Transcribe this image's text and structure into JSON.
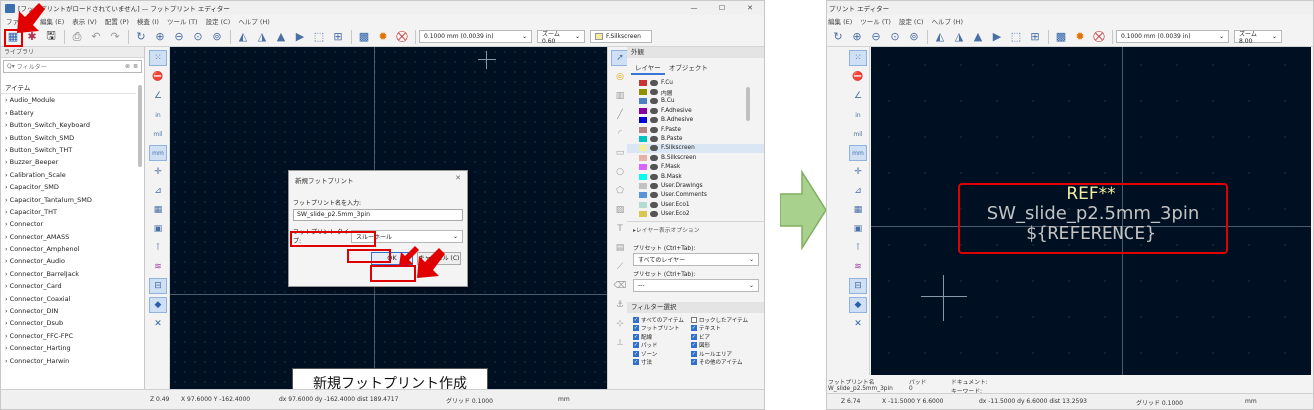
{
  "left": {
    "title": "[フットプリントがロードされていません] — フットプリント エディター",
    "menu": [
      "ファイル",
      "編集 (E)",
      "表示 (V)",
      "配置 (P)",
      "検査 (I)",
      "ツール (T)",
      "設定 (C)",
      "ヘルプ (H)"
    ],
    "grid_combo": "0.1000 mm (0.0039 in)",
    "zoom_combo": "ズーム 0.60",
    "layer_combo": "F.Silkscreen",
    "library": {
      "header": "ライブラリ",
      "search_placeholder": "フィルター",
      "column": "アイテム",
      "items": [
        "Audio_Module",
        "Battery",
        "Button_Switch_Keyboard",
        "Button_Switch_SMD",
        "Button_Switch_THT",
        "Buzzer_Beeper",
        "Calibration_Scale",
        "Capacitor_SMD",
        "Capacitor_Tantalum_SMD",
        "Capacitor_THT",
        "Connector",
        "Connector_AMASS",
        "Connector_Amphenol",
        "Connector_Audio",
        "Connector_BarrelJack",
        "Connector_Card",
        "Connector_Coaxial",
        "Connector_DIN",
        "Connector_Dsub",
        "Connector_FFC-FPC",
        "Connector_Harting",
        "Connector_Harwin"
      ]
    },
    "appearance": {
      "title": "外観",
      "tab_layers": "レイヤー",
      "tab_objects": "オブジェクト",
      "layers": [
        {
          "name": "F.Cu",
          "color": "#c83434"
        },
        {
          "name": "内層",
          "color": "#8f8f00"
        },
        {
          "name": "B.Cu",
          "color": "#4d7fc4"
        },
        {
          "name": "F.Adhesive",
          "color": "#84009e"
        },
        {
          "name": "B.Adhesive",
          "color": "#0000d4"
        },
        {
          "name": "F.Paste",
          "color": "#b48484"
        },
        {
          "name": "B.Paste",
          "color": "#00c2c2"
        },
        {
          "name": "F.Silkscreen",
          "color": "#f2eda1"
        },
        {
          "name": "B.Silkscreen",
          "color": "#e8b2a7"
        },
        {
          "name": "F.Mask",
          "color": "#d864ff"
        },
        {
          "name": "B.Mask",
          "color": "#02ffee"
        },
        {
          "name": "User.Drawings",
          "color": "#c2c2c2"
        },
        {
          "name": "User.Comments",
          "color": "#5994dc"
        },
        {
          "name": "User.Eco1",
          "color": "#b4dbd2"
        },
        {
          "name": "User.Eco2",
          "color": "#d8c852"
        }
      ],
      "layer_display_options": "▸レイヤー表示オプション",
      "preset_label": "プリセット (Ctrl+Tab):",
      "preset_value": "すべてのレイヤー",
      "viewport_label": "プリセット (Ctrl+Tab):",
      "viewport_value": "---",
      "filter_title": "フィルター選択",
      "filters": [
        {
          "label": "すべてのアイテム",
          "checked": true
        },
        {
          "label": "ロックしたアイテム",
          "checked": false
        },
        {
          "label": "フットプリント",
          "checked": true
        },
        {
          "label": "テキスト",
          "checked": true
        },
        {
          "label": "配線",
          "checked": true
        },
        {
          "label": "ビア",
          "checked": true
        },
        {
          "label": "パッド",
          "checked": true
        },
        {
          "label": "図形",
          "checked": true
        },
        {
          "label": "ゾーン",
          "checked": true
        },
        {
          "label": "ルールエリア",
          "checked": true
        },
        {
          "label": "寸法",
          "checked": true
        },
        {
          "label": "その他のアイテム",
          "checked": true
        }
      ]
    },
    "dialog": {
      "title": "新規フットプリント",
      "name_label": "フットプリント名を入力:",
      "name_value": "SW_slide_p2.5mm_3pin",
      "type_label": "フットプリント タイプ:",
      "type_value": "スルーホール",
      "ok": "OK",
      "cancel": "キャンセル (C)"
    },
    "caption": "新規フットプリント作成",
    "status": {
      "zoom": "Z 0.49",
      "xy": "X 97.6000  Y -162.4000",
      "d": "dx 97.6000  dy -162.4000  dist 189.4717",
      "grid": "グリッド 0.1000",
      "unit": "mm"
    }
  },
  "right": {
    "title": "プリント エディター",
    "menu": [
      "編集 (E)",
      "ツール (T)",
      "設定 (C)",
      "ヘルプ (H)"
    ],
    "grid_combo": "0.1000 mm (0.0039 in)",
    "zoom_combo": "ズーム 8.00",
    "footprint_text": {
      "ref": "REF**",
      "value": "SW_slide_p2.5mm_3pin",
      "reference": "${REFERENCE}"
    },
    "info": {
      "fp_name_label": "フットプリント名",
      "fp_name_value": "W_slide_p2.5mm_3pin",
      "pads_label": "パッド",
      "pads_value": "0",
      "doc_label": "ドキュメント:",
      "kw_label": "キーワード:"
    },
    "status": {
      "zoom": "Z 6.74",
      "xy": "X -11.5000  Y 6.6000",
      "d": "dx -11.5000  dy 6.6000  dist 13.2593",
      "grid": "グリッド 0.1000",
      "unit": "mm"
    }
  },
  "colors": {
    "canvas": "#001023",
    "silk": "#f2eda1",
    "highlight": "#e00000",
    "transition_arrow": "#a9d18e"
  }
}
